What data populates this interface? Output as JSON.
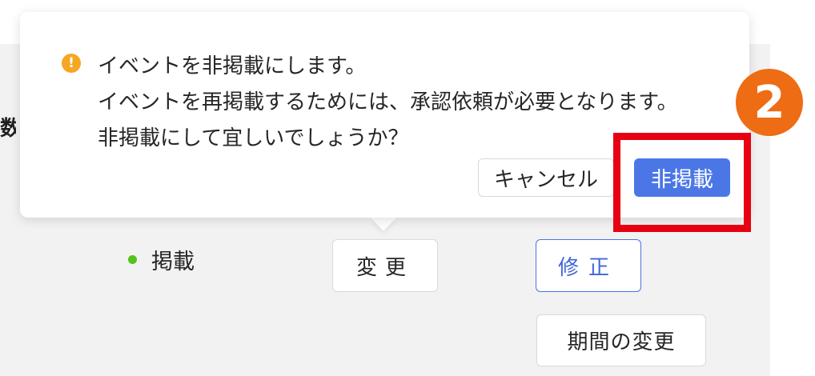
{
  "popover": {
    "message_line1": "イベントを非掲載にします。",
    "message_line2": "イベントを再掲載するためには、承認依頼が必要となります。",
    "message_line3": "非掲載にして宜しいでしょうか？",
    "cancel_label": "キャンセル",
    "confirm_label": "非掲載",
    "warning_icon": "warning-circle-icon"
  },
  "page": {
    "left_label_fragment": "数",
    "status_label": "掲載",
    "status_color": "#52c41a",
    "change_button": "変更",
    "edit_button": "修正",
    "period_button": "期間の変更"
  },
  "annotation": {
    "step_number": "2",
    "highlight_color": "#e60012",
    "badge_color": "#ee6c14"
  },
  "colors": {
    "primary": "#4b77e6",
    "warning": "#f5a623"
  }
}
